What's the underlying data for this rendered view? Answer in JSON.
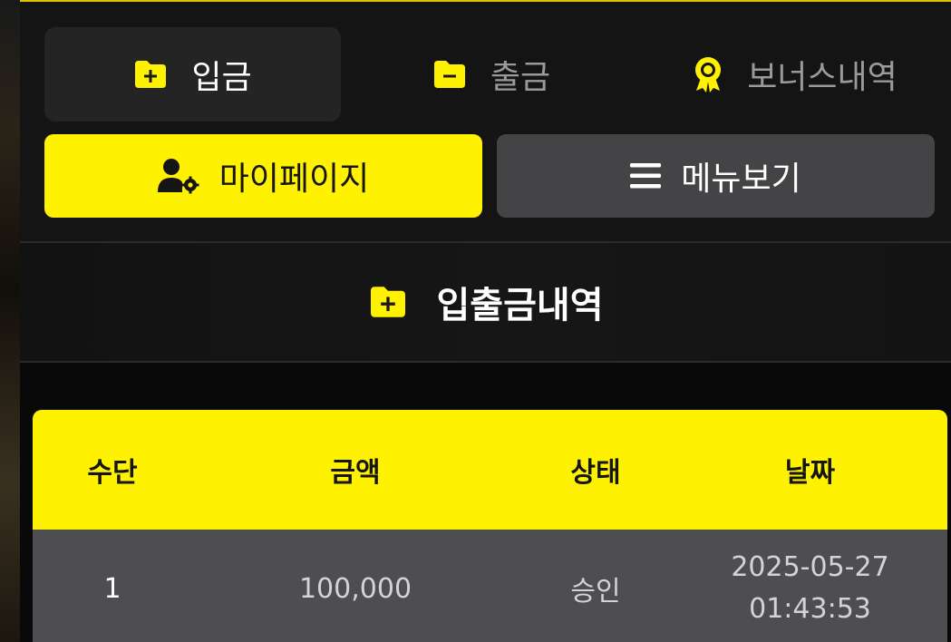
{
  "tabs": [
    {
      "label": "입금",
      "icon": "folder-plus-icon",
      "active": true
    },
    {
      "label": "출금",
      "icon": "folder-minus-icon",
      "active": false
    },
    {
      "label": "보너스내역",
      "icon": "award-badge-icon",
      "active": false
    }
  ],
  "buttons": {
    "mypage_label": "마이페이지",
    "mypage_icon": "user-gear-icon",
    "menu_label": "메뉴보기",
    "menu_icon": "hamburger-icon"
  },
  "section": {
    "title": "입출금내역",
    "icon": "folder-plus-icon"
  },
  "table": {
    "headers": [
      "수단",
      "금액",
      "상태",
      "날짜"
    ],
    "rows": [
      {
        "method": "1",
        "amount": "100,000",
        "status": "승인",
        "date": "2025-05-27",
        "time": "01:43:53"
      }
    ]
  },
  "colors": {
    "accent": "#fff200",
    "background": "#141414",
    "row": "#4d4d52"
  }
}
